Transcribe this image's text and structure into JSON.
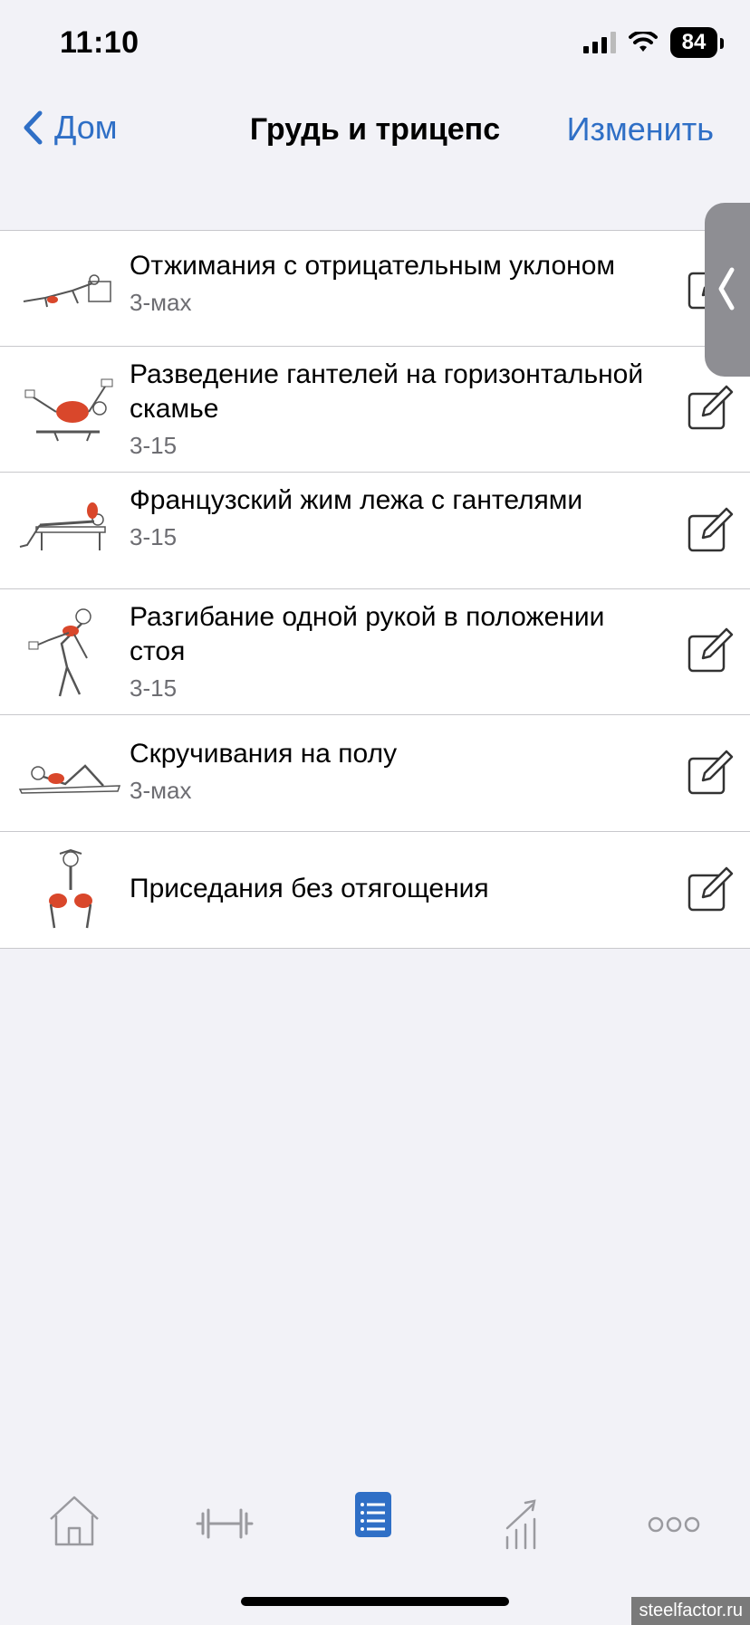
{
  "status_bar": {
    "time": "11:10",
    "battery": "84"
  },
  "nav": {
    "back_label": "Дом",
    "title": "Грудь и трицепс",
    "edit_label": "Изменить"
  },
  "exercises": [
    {
      "title": "Отжимания с отрицательным уклоном",
      "sets": "3-мах"
    },
    {
      "title": "Разведение гантелей на горизонтальной скамье",
      "sets": "3-15"
    },
    {
      "title": "Французский жим лежа с гантелями",
      "sets": "3-15"
    },
    {
      "title": "Разгибание одной рукой в положении стоя",
      "sets": "3-15"
    },
    {
      "title": "Скручивания на полу",
      "sets": "3-мах"
    },
    {
      "title": "Приседания без отягощения",
      "sets": ""
    }
  ],
  "tabs": [
    {
      "icon": "home-icon",
      "active": false
    },
    {
      "icon": "dumbbell-icon",
      "active": false
    },
    {
      "icon": "list-icon",
      "active": true
    },
    {
      "icon": "chart-icon",
      "active": false
    },
    {
      "icon": "more-icon",
      "active": false
    }
  ],
  "colors": {
    "accent": "#2f6fc6",
    "muscle_highlight": "#d9472b"
  },
  "watermark": "steelfactor.ru"
}
